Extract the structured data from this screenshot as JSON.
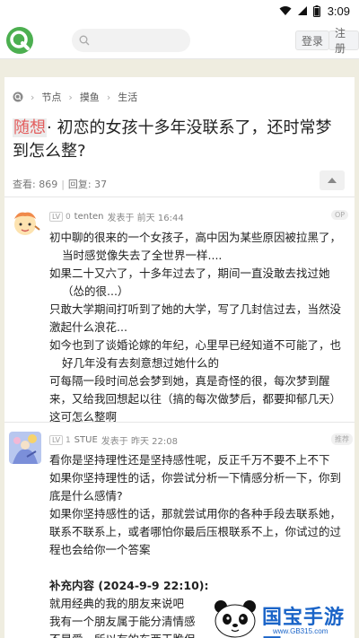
{
  "status_bar": {
    "time": "3:09"
  },
  "header": {
    "search_placeholder": "",
    "login_label": "登录",
    "register_label": "注册"
  },
  "breadcrumb": {
    "items": [
      "节点",
      "摸鱼",
      "生活"
    ]
  },
  "post": {
    "tag": "随想",
    "title": "· 初恋的女孩十多年没联系了，还时常梦到怎么整?",
    "views": "查看: 869",
    "replies": "回复: 37"
  },
  "replies": [
    {
      "level": "LV",
      "level_num": "0",
      "user": "tenten",
      "time": "发表于 前天 16:44",
      "badge": "OP",
      "lines": [
        "初中聊的很来的一个女孩子，高中因为某些原因被拉黑了，",
        "当时感觉像失去了全世界一样....",
        "如果二十又六了，十多年过去了，期间一直没敢去找过她",
        "（怂的很...）",
        "只敢大学期间打听到了她的大学，写了几封信过去，当然没",
        "激起什么浪花...",
        "如今也到了谈婚论嫁的年纪，心里早已经知道不可能了，也",
        "好几年没有去刻意想过她什么的",
        "可每隔一段时间总会梦到她，真是奇怪的很，每次梦到醒",
        "来，又给我回想起以往（搞的每次做梦后，都要抑郁几天）",
        "这可怎么整啊"
      ]
    },
    {
      "level": "LV",
      "level_num": "1",
      "user": "STUE",
      "time": "发表于 昨天 22:08",
      "badge": "推荐",
      "lines": [
        "看你是坚持理性还是坚持感性呢，反正千万不要不上不下",
        "如果你坚持理性的话，你尝试分析一下情感分析一下，你到",
        "底是什么感情?",
        "如果你坚持感性的话，那就尝试用你的各种手段去联系她，",
        "联系不联系上，或者哪怕你最后压根联系不上，你试过的过",
        "程也会给你一个答案"
      ],
      "supplement_title": "补充内容 (2024-9-9 22:10):",
      "supplement_lines": [
        "就用经典的我的朋友来说吧",
        "我有一个朋友属于能分清情感",
        "不是爱，所以有的东西干脆保"
      ]
    }
  ],
  "watermark": {
    "text": "国宝手游网",
    "url": "www.GB315.com"
  },
  "colors": {
    "accent": "#4caf50",
    "tag": "#e35d5d",
    "watermark": "#1a64c8"
  }
}
